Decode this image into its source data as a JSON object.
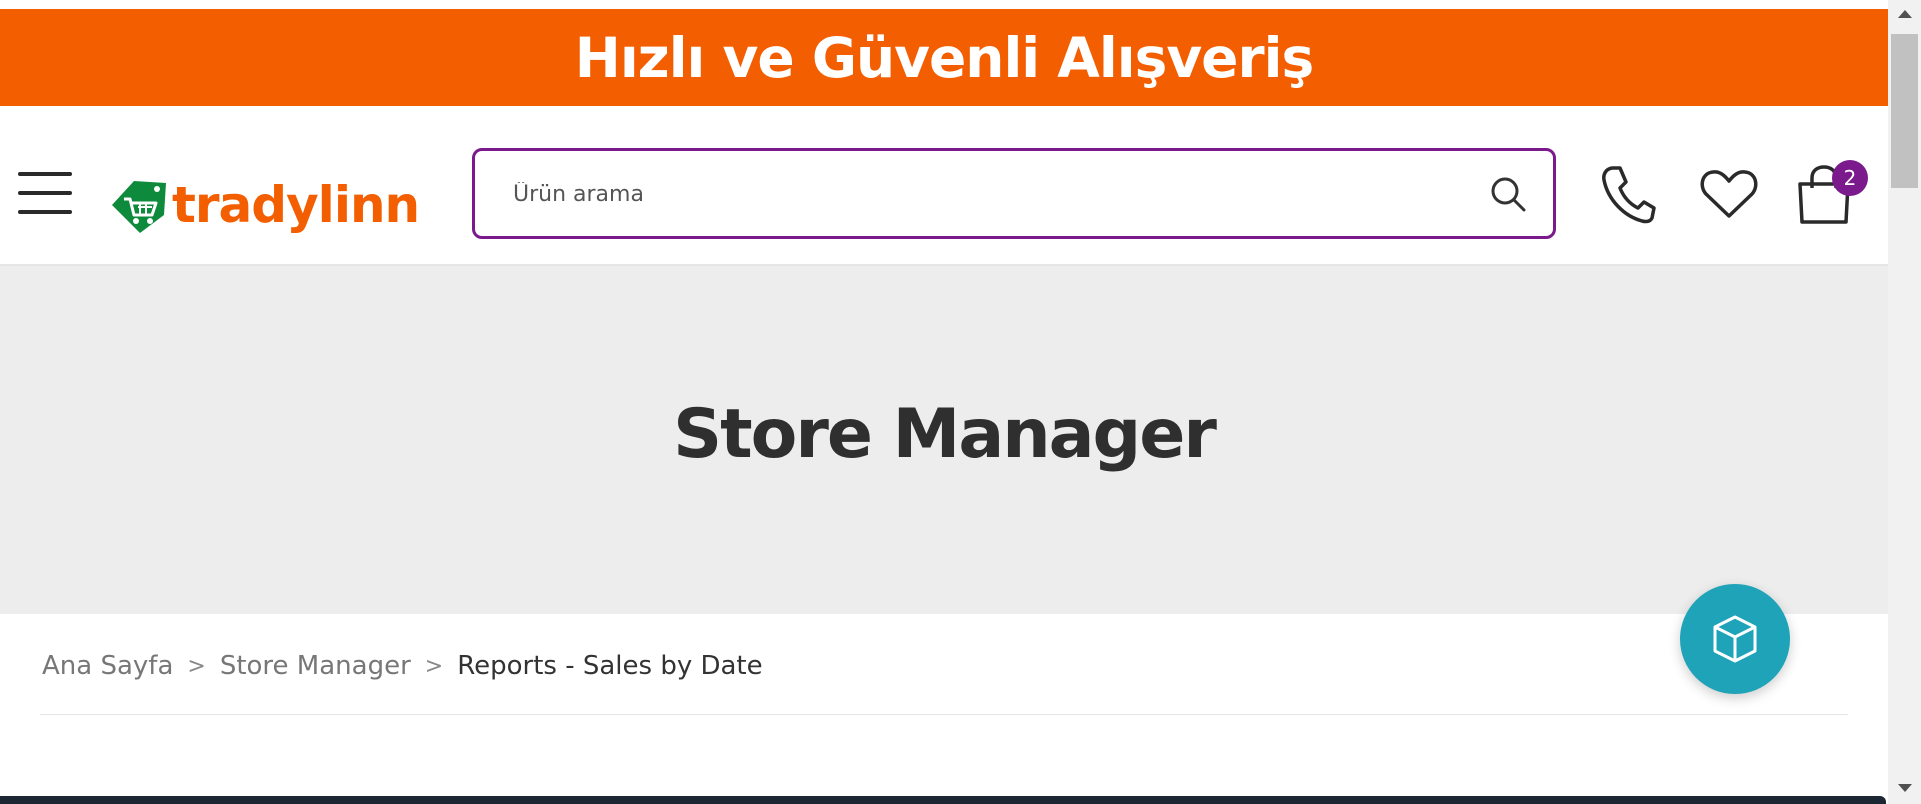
{
  "banner": {
    "text": "Hızlı ve Güvenli Alışveriş",
    "color": "#f35e00"
  },
  "header": {
    "logo_text": "tradylinn",
    "search": {
      "placeholder": "Ürün arama",
      "value": ""
    },
    "icons": [
      "menu-icon",
      "phone-icon",
      "heart-icon",
      "shopping-bag-icon",
      "search-icon"
    ],
    "cart_count": "2",
    "accent_color": "#7a1a8c"
  },
  "hero": {
    "title": "Store Manager"
  },
  "breadcrumb": {
    "items": [
      "Ana Sayfa",
      "Store Manager",
      "Reports - Sales by Date"
    ],
    "separator": ">"
  },
  "fab": {
    "icon": "cube-icon",
    "color": "#1fa3b8"
  }
}
